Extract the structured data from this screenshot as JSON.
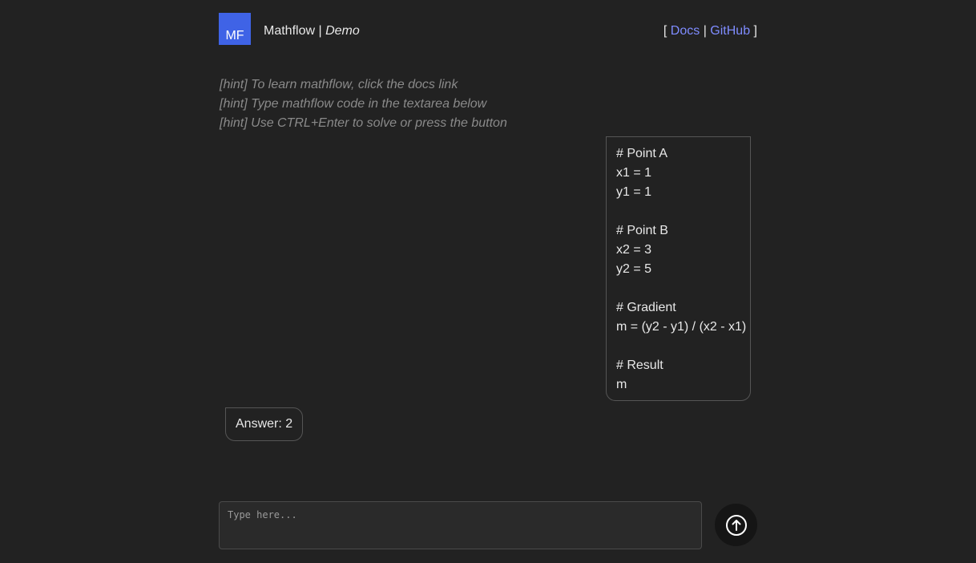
{
  "header": {
    "logo_text": "MF",
    "app_name": "Mathflow",
    "separator": "|",
    "subtitle": "Demo",
    "bracket_open": "[",
    "docs_link": "Docs",
    "link_separator": "|",
    "github_link": "GitHub",
    "bracket_close": "]"
  },
  "hints": [
    "[hint] To learn mathflow, click the docs link",
    "[hint] Type mathflow code in the textarea below",
    "[hint] Use CTRL+Enter to solve or press the button"
  ],
  "code_message": {
    "lines": [
      "# Point A",
      "x1 = 1",
      "y1 = 1",
      "",
      "# Point B",
      "x2 = 3",
      "y2 = 5",
      "",
      "# Gradient",
      "m = (y2 - y1) / (x2 - x1)",
      "",
      "# Result",
      "m"
    ]
  },
  "answer": {
    "text": "Answer: 2"
  },
  "input": {
    "placeholder": "Type here...",
    "value": ""
  },
  "send_button": {
    "icon": "arrow-up-circle-icon"
  },
  "colors": {
    "background": "#222222",
    "logo_bg": "#3f63e6",
    "link": "#7f8cff",
    "hint": "#8a8a8a",
    "border": "#555555"
  }
}
